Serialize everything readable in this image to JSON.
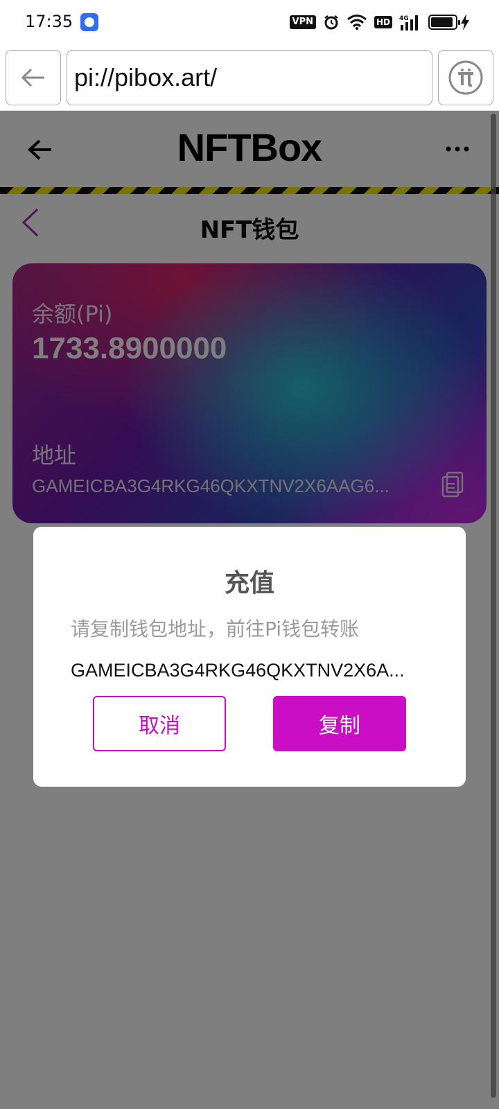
{
  "status_bar": {
    "time": "17:35",
    "vpn_label": "VPN",
    "hd_label": "HD",
    "network_label": "4G",
    "battery_level": 0.9,
    "icons": [
      "baidu-app-icon",
      "alarm-icon",
      "wifi-icon",
      "signal-icon",
      "battery-icon",
      "charging-icon"
    ]
  },
  "browser": {
    "url": "pi://pibox.art/",
    "back_icon": "arrow-left-icon",
    "pi_icon": "pi-logo-icon"
  },
  "app_header": {
    "title": "NFTBox",
    "back_icon": "arrow-left-icon",
    "more_icon": "more-dots-icon"
  },
  "page": {
    "title": "NFT钱包",
    "back_icon": "chevron-left-icon"
  },
  "wallet_card": {
    "balance_label": "余额(Pi)",
    "balance_value": "1733.8900000",
    "address_label": "地址",
    "address_value": "GAMEICBA3G4RKG46QKXTNV2X6AAG6...",
    "copy_icon": "copy-icon"
  },
  "dialog": {
    "title": "充值",
    "message": "请复制钱包地址，前往Pi钱包转账",
    "address": "GAMEICBA3G4RKG46QKXTNV2X6A...",
    "cancel_label": "取消",
    "copy_label": "复制"
  },
  "colors": {
    "accent": "#c90ec6",
    "overlay": "#000000",
    "hazard_yellow": "#f3e600",
    "hazard_black": "#111111"
  }
}
